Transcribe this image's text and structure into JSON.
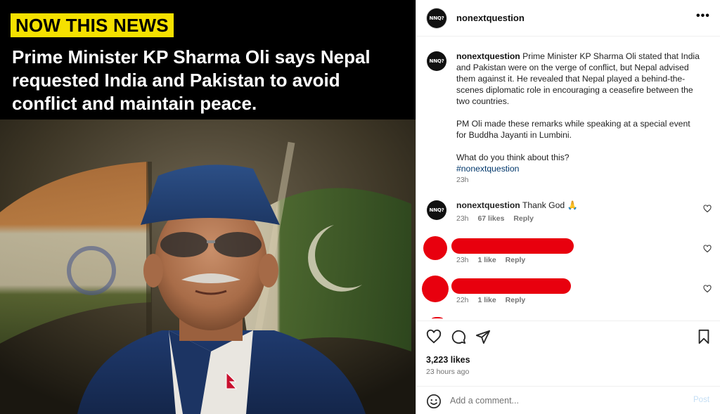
{
  "post": {
    "tag": "NOW THIS NEWS",
    "headline": "Prime Minister KP Sharma Oli says Nepal requested India and Pakistan to avoid conflict and maintain peace."
  },
  "header": {
    "avatar_text": "NNQ?",
    "username": "nonextquestion",
    "more_label": "•••"
  },
  "caption": {
    "username": "nonextquestion",
    "paragraph1": "Prime Minister KP Sharma Oli stated that India and Pakistan were on the verge of conflict, but Nepal advised them against it. He revealed that Nepal played a behind-the-scenes diplomatic role in encouraging a ceasefire between the two countries.",
    "paragraph2": "PM Oli made these remarks while speaking at a special event for Buddha Jayanti in Lumbini.",
    "paragraph3": "What do you think about this?",
    "hashtag": "#nonextquestion",
    "age": "23h"
  },
  "comments": [
    {
      "username": "nonextquestion",
      "text": "Thank God 🙏",
      "age": "23h",
      "likes": "67 likes",
      "reply": "Reply"
    },
    {
      "username": "",
      "text": "",
      "age": "23h",
      "likes": "1 like",
      "reply": "Reply"
    },
    {
      "username": "",
      "text": "",
      "age": "22h",
      "likes": "1 like",
      "reply": "Reply"
    }
  ],
  "actions": {
    "likes": "3,223 likes",
    "time": "23 hours ago"
  },
  "add_comment": {
    "placeholder": "Add a comment...",
    "post_label": "Post"
  },
  "colors": {
    "tag_bg": "#f5e100",
    "redaction": "#e8000e",
    "hashtag": "#00376b",
    "post_disabled": "#c4def5"
  }
}
